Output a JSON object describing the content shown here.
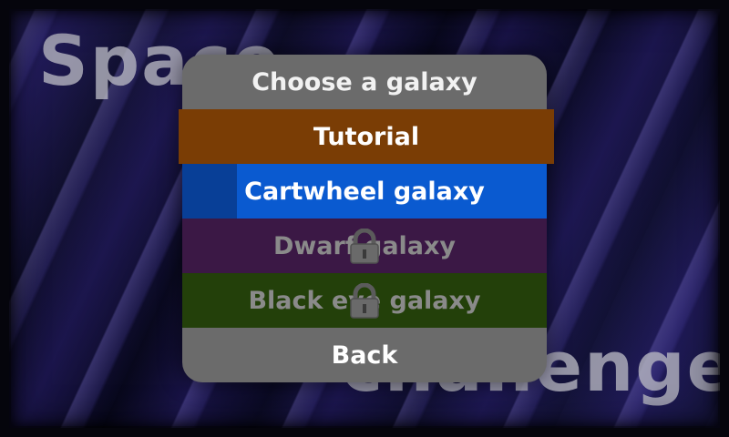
{
  "title": {
    "line1": "Space",
    "line2": "challenge"
  },
  "menu": {
    "heading": "Choose a galaxy",
    "items": [
      {
        "label": "Tutorial",
        "color": "#7a3d05",
        "locked": false
      },
      {
        "label": "Cartwheel galaxy",
        "color": "#0a5ad0",
        "locked": false,
        "selected": true
      },
      {
        "label": "Dwarf galaxy",
        "color": "#3b1845",
        "locked": true,
        "icon": "lock-icon"
      },
      {
        "label": "Black eye galaxy",
        "color": "#23400a",
        "locked": true,
        "icon": "lock-icon"
      }
    ],
    "back_label": "Back"
  }
}
